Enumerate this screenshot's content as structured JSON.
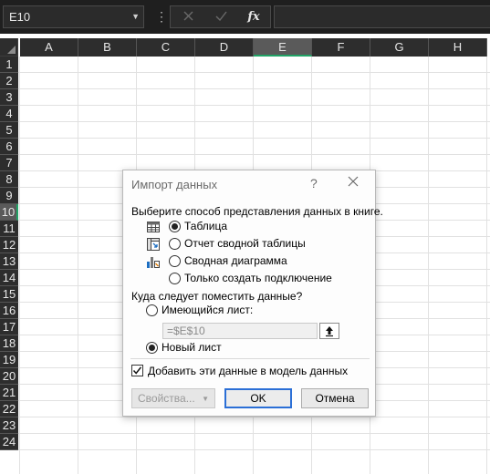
{
  "formula_bar": {
    "name_box": "E10",
    "fx_label": "fx",
    "formula_value": ""
  },
  "sheet": {
    "columns": [
      "A",
      "B",
      "C",
      "D",
      "E",
      "F",
      "G",
      "H"
    ],
    "rows": [
      "1",
      "2",
      "3",
      "4",
      "5",
      "6",
      "7",
      "8",
      "9",
      "10",
      "11",
      "12",
      "13",
      "14",
      "15",
      "16",
      "17",
      "18",
      "19",
      "20",
      "21",
      "22",
      "23",
      "24"
    ],
    "active_column": "E",
    "active_row": "10",
    "colors": {
      "header_bg": "#2d2d2d",
      "active_accent": "#21a366"
    }
  },
  "dialog": {
    "title": "Импорт данных",
    "help_label": "?",
    "view_prompt": "Выберите способ представления данных в книге.",
    "view_options": [
      {
        "label": "Таблица",
        "checked": true,
        "icon": "table-icon"
      },
      {
        "label": "Отчет сводной таблицы",
        "checked": false,
        "icon": "pivot-table-icon"
      },
      {
        "label": "Сводная диаграмма",
        "checked": false,
        "icon": "pivot-chart-icon"
      },
      {
        "label": "Только создать подключение",
        "checked": false,
        "icon": "connection-icon"
      }
    ],
    "location_prompt": "Куда следует поместить данные?",
    "location_options": [
      {
        "label": "Имеющийся лист:",
        "checked": false
      },
      {
        "label": "Новый лист",
        "checked": true
      }
    ],
    "reference_value": "=$E$10",
    "add_to_model_label": "Добавить эти данные в модель данных",
    "add_to_model_checked": true,
    "properties_button": "Свойства...",
    "ok_button": "OK",
    "cancel_button": "Отмена"
  }
}
